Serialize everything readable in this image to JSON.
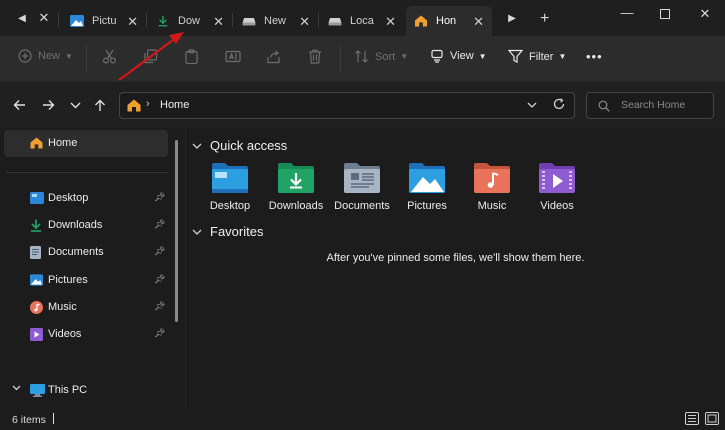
{
  "tabs": [
    {
      "label": "Pictu",
      "icon": "pictures-icon"
    },
    {
      "label": "Dow",
      "icon": "download-icon"
    },
    {
      "label": "New",
      "icon": "drive-icon"
    },
    {
      "label": "Loca",
      "icon": "drive-icon"
    },
    {
      "label": "Hon",
      "icon": "home-icon",
      "active": true
    }
  ],
  "toolbar": {
    "new_label": "New",
    "sort_label": "Sort",
    "view_label": "View",
    "filter_label": "Filter",
    "more_label": "•••"
  },
  "address": {
    "crumb": "Home",
    "search_placeholder": "Search Home"
  },
  "sidebar": {
    "home": "Home",
    "items": [
      {
        "label": "Desktop",
        "icon": "desktop-icon"
      },
      {
        "label": "Downloads",
        "icon": "downloads-icon"
      },
      {
        "label": "Documents",
        "icon": "documents-icon"
      },
      {
        "label": "Pictures",
        "icon": "pictures-icon"
      },
      {
        "label": "Music",
        "icon": "music-icon"
      },
      {
        "label": "Videos",
        "icon": "videos-icon"
      }
    ],
    "this_pc": "This PC"
  },
  "main": {
    "quick_access_title": "Quick access",
    "quick_access": [
      {
        "label": "Desktop",
        "color": "#2b88d8"
      },
      {
        "label": "Downloads",
        "color": "#21a366"
      },
      {
        "label": "Documents",
        "color": "#8a9bb0"
      },
      {
        "label": "Pictures",
        "color": "#2b88d8"
      },
      {
        "label": "Music",
        "color": "#e8735a"
      },
      {
        "label": "Videos",
        "color": "#8e5bd1"
      }
    ],
    "favorites_title": "Favorites",
    "favorites_empty": "After you've pinned some files, we'll show them here."
  },
  "status": {
    "item_count": "6 items"
  },
  "colors": {
    "annotation_arrow": "#d01818",
    "accent": "#2b88d8"
  }
}
